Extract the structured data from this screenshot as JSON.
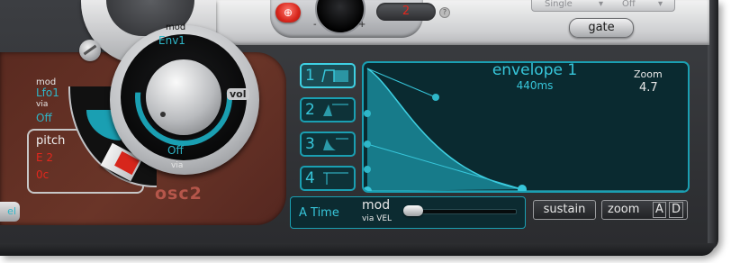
{
  "header": {
    "num_display": "2",
    "mini_minus": "-",
    "mini_plus": "+",
    "dropdown_left": "Single",
    "dropdown_right": "Off",
    "gate_label": "gate"
  },
  "osc": {
    "label": "osc2",
    "mod_top_label": "mod",
    "mod_top_source": "Env1",
    "vol_label": "vol",
    "dial_via_value": "Off",
    "dial_via_label": "via",
    "left_mod_label": "mod",
    "left_mod_source": "Lfo1",
    "left_via_label": "via",
    "left_via_value": "Off",
    "pitch_label": "pitch",
    "pitch_value": "E 2",
    "cent_value": "0c",
    "side_tab_label": "el"
  },
  "envelope": {
    "selectors": [
      {
        "num": "1"
      },
      {
        "num": "2"
      },
      {
        "num": "3"
      },
      {
        "num": "4"
      }
    ],
    "title": "envelope 1",
    "time": "440ms",
    "zoom_label": "Zoom",
    "zoom_value": "4.7"
  },
  "bottom": {
    "a_time_label": "A Time",
    "mod_label": "mod",
    "via_label": "via VEL",
    "sustain_label": "sustain",
    "zoom_label": "zoom",
    "zoom_a": "A",
    "zoom_d": "D"
  },
  "colors": {
    "accent": "#37c6da",
    "red": "#e2271d",
    "brown": "#6a3528"
  }
}
